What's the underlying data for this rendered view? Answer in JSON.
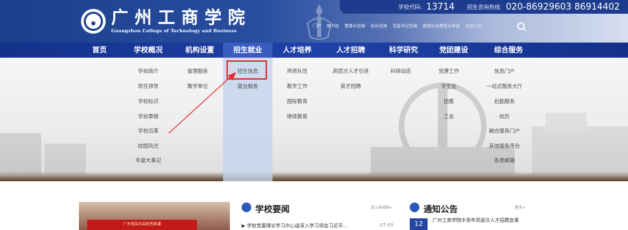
{
  "header": {
    "logo_cn": "广州工商学院",
    "logo_en": "Guangzhou College of Technology and Business",
    "code_label": "学校代码:",
    "code_value": "13714",
    "hotline_label": "招生咨询热线:",
    "hotline_value": "020-86929603 86914402",
    "top_links": [
      "门户",
      "图书馆",
      "董事长信箱",
      "校长信箱",
      "党委书记信箱",
      "教育乱收费投诉举报",
      "信息公开"
    ]
  },
  "nav": {
    "items": [
      "首页",
      "学校概况",
      "机构设置",
      "招生就业",
      "人才培养",
      "人才招聘",
      "科学研究",
      "党团建设",
      "综合服务"
    ],
    "active_index": 3
  },
  "dropdown": {
    "columns": [
      [
        "学校简介",
        "现任领导",
        "学校标识",
        "学校章程",
        "学校沿革",
        "校园风光",
        "年度大事记"
      ],
      [
        "管理服务",
        "教学单位"
      ],
      [
        "招生信息",
        "就业服务"
      ],
      [
        "师资队伍",
        "教学工作",
        "国际教育",
        "继续教育"
      ],
      [
        "高层次人才引进",
        "英才招聘"
      ],
      [
        "科研动态"
      ],
      [
        "党建工作",
        "学生处",
        "团委",
        "工会"
      ],
      [
        "信息门户",
        "一站式服务大厅",
        "后勤服务",
        "校历",
        "融合服务门户",
        "其他服务平台",
        "各类邮箱"
      ]
    ],
    "highlighted": "招生信息"
  },
  "bottom": {
    "photo_caption": "广东省民办高校思政课",
    "news": {
      "title": "学校要闻",
      "more": "进入新闻网+",
      "item_text": "▶ 学校党委理论学习中心组深入学习领会习近平...",
      "item_date": "07-05"
    },
    "notice": {
      "title": "通知公告",
      "more": "更多+",
      "date_day": "12",
      "item_text": "广州工商学院中青年高层次人才招聘启事"
    }
  },
  "colors": {
    "header_blue": "#1c3f8c",
    "nav_blue": "#1e3ea0",
    "highlight_red": "#e02a2a",
    "notice_blue": "#2746a3"
  }
}
